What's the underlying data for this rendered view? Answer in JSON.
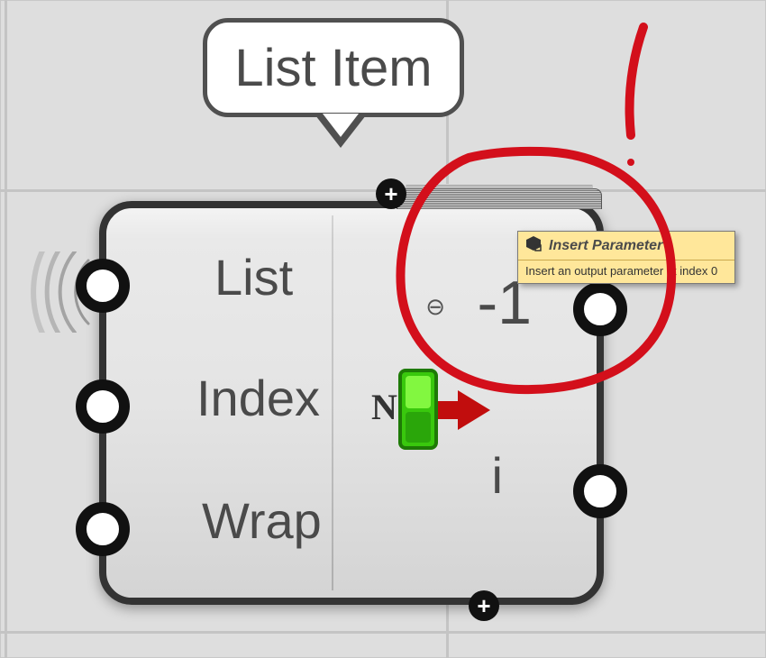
{
  "component": {
    "title": "List Item",
    "inputs": [
      {
        "label": "List"
      },
      {
        "label": "Index"
      },
      {
        "label": "Wrap"
      }
    ],
    "outputs": [
      {
        "label": "-1",
        "modifier": "⊖"
      },
      {
        "label": "i"
      }
    ],
    "centerGlyph": "N"
  },
  "insertMenu": {
    "plusGlyph": "+",
    "tooltip": {
      "title": "Insert Parameter",
      "description": "Insert an output parameter at index 0"
    }
  }
}
